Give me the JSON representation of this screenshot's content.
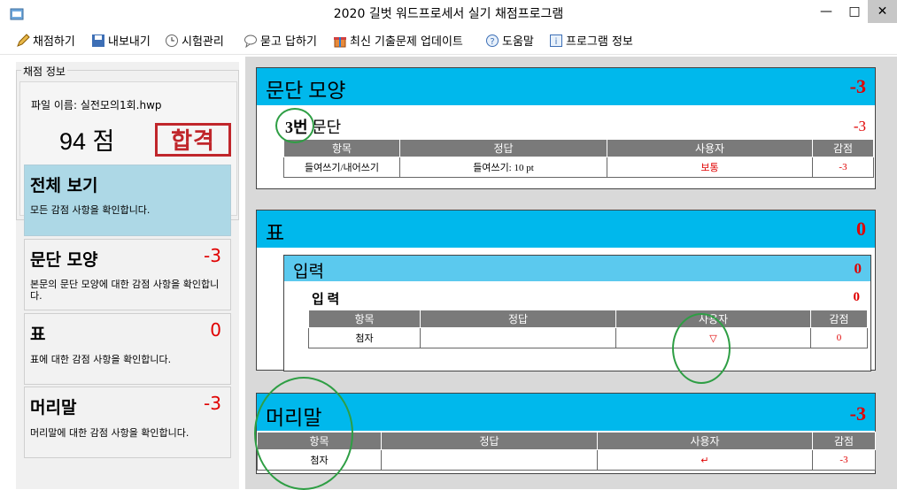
{
  "window": {
    "title": "2020 길벗 워드프로세서 실기 채점프로그램",
    "min": "—",
    "max": "□",
    "close": "✕"
  },
  "toolbar": [
    {
      "label": "채점하기",
      "icon": "pencil-icon"
    },
    {
      "label": "내보내기",
      "icon": "save-icon"
    },
    {
      "label": "시험관리",
      "icon": "clock-icon"
    },
    {
      "label": "묻고 답하기",
      "icon": "speech-icon"
    },
    {
      "label": "최신 기출문제 업데이트",
      "icon": "gift-icon"
    },
    {
      "label": "도움말",
      "icon": "help-icon"
    },
    {
      "label": "프로그램 정보",
      "icon": "info-icon"
    }
  ],
  "info": {
    "legend": "채점 정보",
    "file_name": "파일 이름: 실전모의1회.hwp",
    "score": "94 점",
    "stamp": "합격"
  },
  "categories": [
    {
      "title": "전체 보기",
      "score": "",
      "desc": "모든 감점 사항을 확인합니다."
    },
    {
      "title": "문단 모양",
      "score": "-3",
      "desc": "본문의 문단 모양에 대한 감점 사항을 확인합니다."
    },
    {
      "title": "표",
      "score": "0",
      "desc": "표에 대한 감점 사항을 확인합니다."
    },
    {
      "title": "머리말",
      "score": "-3",
      "desc": "머리말에 대한 감점 사항을 확인합니다."
    }
  ],
  "columns": {
    "item": "항목",
    "answer": "정답",
    "user": "사용자",
    "deduct": "감점"
  },
  "sections": [
    {
      "title": "문단 모양",
      "score": "-3",
      "sub": {
        "number": "3번",
        "title": "문단",
        "score": "-3"
      },
      "rows": [
        {
          "item": "들여쓰기/내어쓰기",
          "answer": "들여쓰기: 10 pt",
          "user": "보통",
          "deduct": "-3"
        }
      ]
    },
    {
      "title": "표",
      "score": "0",
      "group": {
        "title": "입력",
        "score": "0"
      },
      "sub": {
        "title": "입 력",
        "score": "0"
      },
      "rows": [
        {
          "item": "첨자",
          "answer": "",
          "user": "▽",
          "deduct": "0"
        }
      ]
    },
    {
      "title": "머리말",
      "score": "-3",
      "rows": [
        {
          "item": "첨자",
          "answer": "",
          "user": "↵",
          "deduct": "-3"
        }
      ]
    }
  ],
  "colors": {
    "header": "#00b8ec",
    "subheader": "#5bc9ee",
    "deduct": "#e00000",
    "active_card": "#add8e6",
    "stamp": "#c0262b",
    "annotation": "#2e9e44"
  }
}
